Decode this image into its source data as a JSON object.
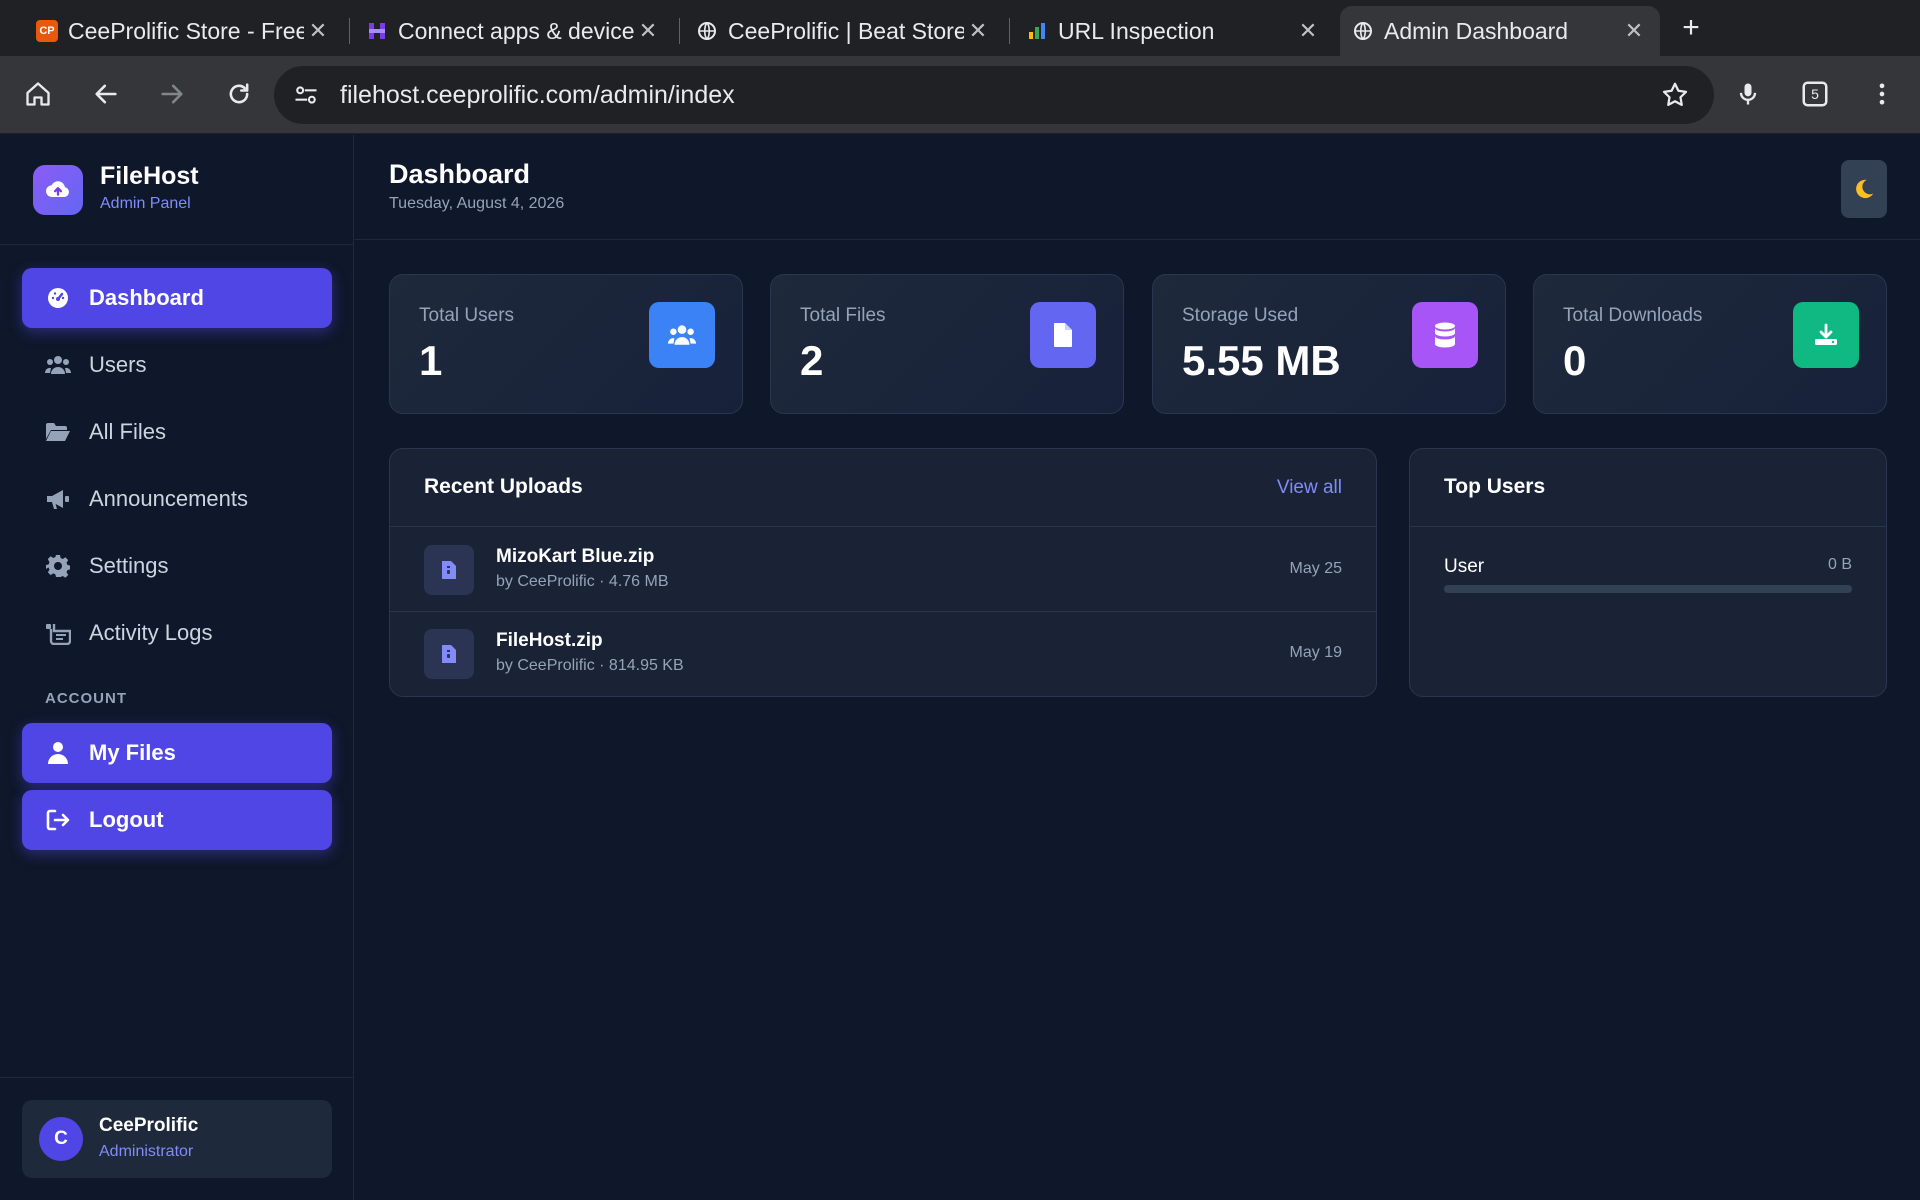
{
  "browser": {
    "tabs": [
      {
        "title": "CeeProlific Store - Free S",
        "favicon": "cp-logo",
        "active": false
      },
      {
        "title": "Connect apps & devices",
        "favicon": "h-logo",
        "active": false
      },
      {
        "title": "CeeProlific | Beat Store,",
        "favicon": "globe-icon",
        "active": false
      },
      {
        "title": "URL Inspection",
        "favicon": "search-console-icon",
        "active": false
      },
      {
        "title": "Admin Dashboard",
        "favicon": "globe-icon",
        "active": true
      }
    ],
    "favicon_cp_text": "CP",
    "url": "filehost.ceeprolific.com/admin/index",
    "extensions_count": "5"
  },
  "sidebar": {
    "brand_name": "FileHost",
    "brand_subtitle": "Admin Panel",
    "nav": [
      {
        "label": "Dashboard",
        "icon": "dashboard-gauge-icon",
        "active": true
      },
      {
        "label": "Users",
        "icon": "users-icon"
      },
      {
        "label": "All Files",
        "icon": "folder-open-icon"
      },
      {
        "label": "Announcements",
        "icon": "megaphone-icon"
      },
      {
        "label": "Settings",
        "icon": "gear-icon"
      },
      {
        "label": "Activity Logs",
        "icon": "activity-log-icon"
      }
    ],
    "account_section": "ACCOUNT",
    "account_nav": [
      {
        "label": "My Files",
        "icon": "user-icon"
      },
      {
        "label": "Logout",
        "icon": "logout-icon"
      }
    ],
    "user": {
      "initial": "C",
      "name": "CeeProlific",
      "role": "Administrator"
    }
  },
  "header": {
    "title": "Dashboard",
    "date": "Tuesday, August 4, 2026"
  },
  "stats": [
    {
      "label": "Total Users",
      "value": "1",
      "icon": "users-icon",
      "color": "#3b82f6"
    },
    {
      "label": "Total Files",
      "value": "2",
      "icon": "file-icon",
      "color": "#6366f1"
    },
    {
      "label": "Storage Used",
      "value": "5.55 MB",
      "icon": "database-icon",
      "color": "#a855f7"
    },
    {
      "label": "Total Downloads",
      "value": "0",
      "icon": "download-icon",
      "color": "#10b981"
    }
  ],
  "recent_uploads": {
    "title": "Recent Uploads",
    "view_all": "View all",
    "items": [
      {
        "name": "MizoKart Blue.zip",
        "meta": "by CeeProlific · 4.76 MB",
        "date": "May 25"
      },
      {
        "name": "FileHost.zip",
        "meta": "by CeeProlific · 814.95 KB",
        "date": "May 19"
      }
    ]
  },
  "top_users": {
    "title": "Top Users",
    "items": [
      {
        "name": "User",
        "size": "0 B",
        "fraction": 0
      }
    ]
  },
  "colors": {
    "accent": "#4f46e5",
    "background": "#0f172a",
    "card": "#1e293b",
    "moon": "#fbbf24"
  }
}
